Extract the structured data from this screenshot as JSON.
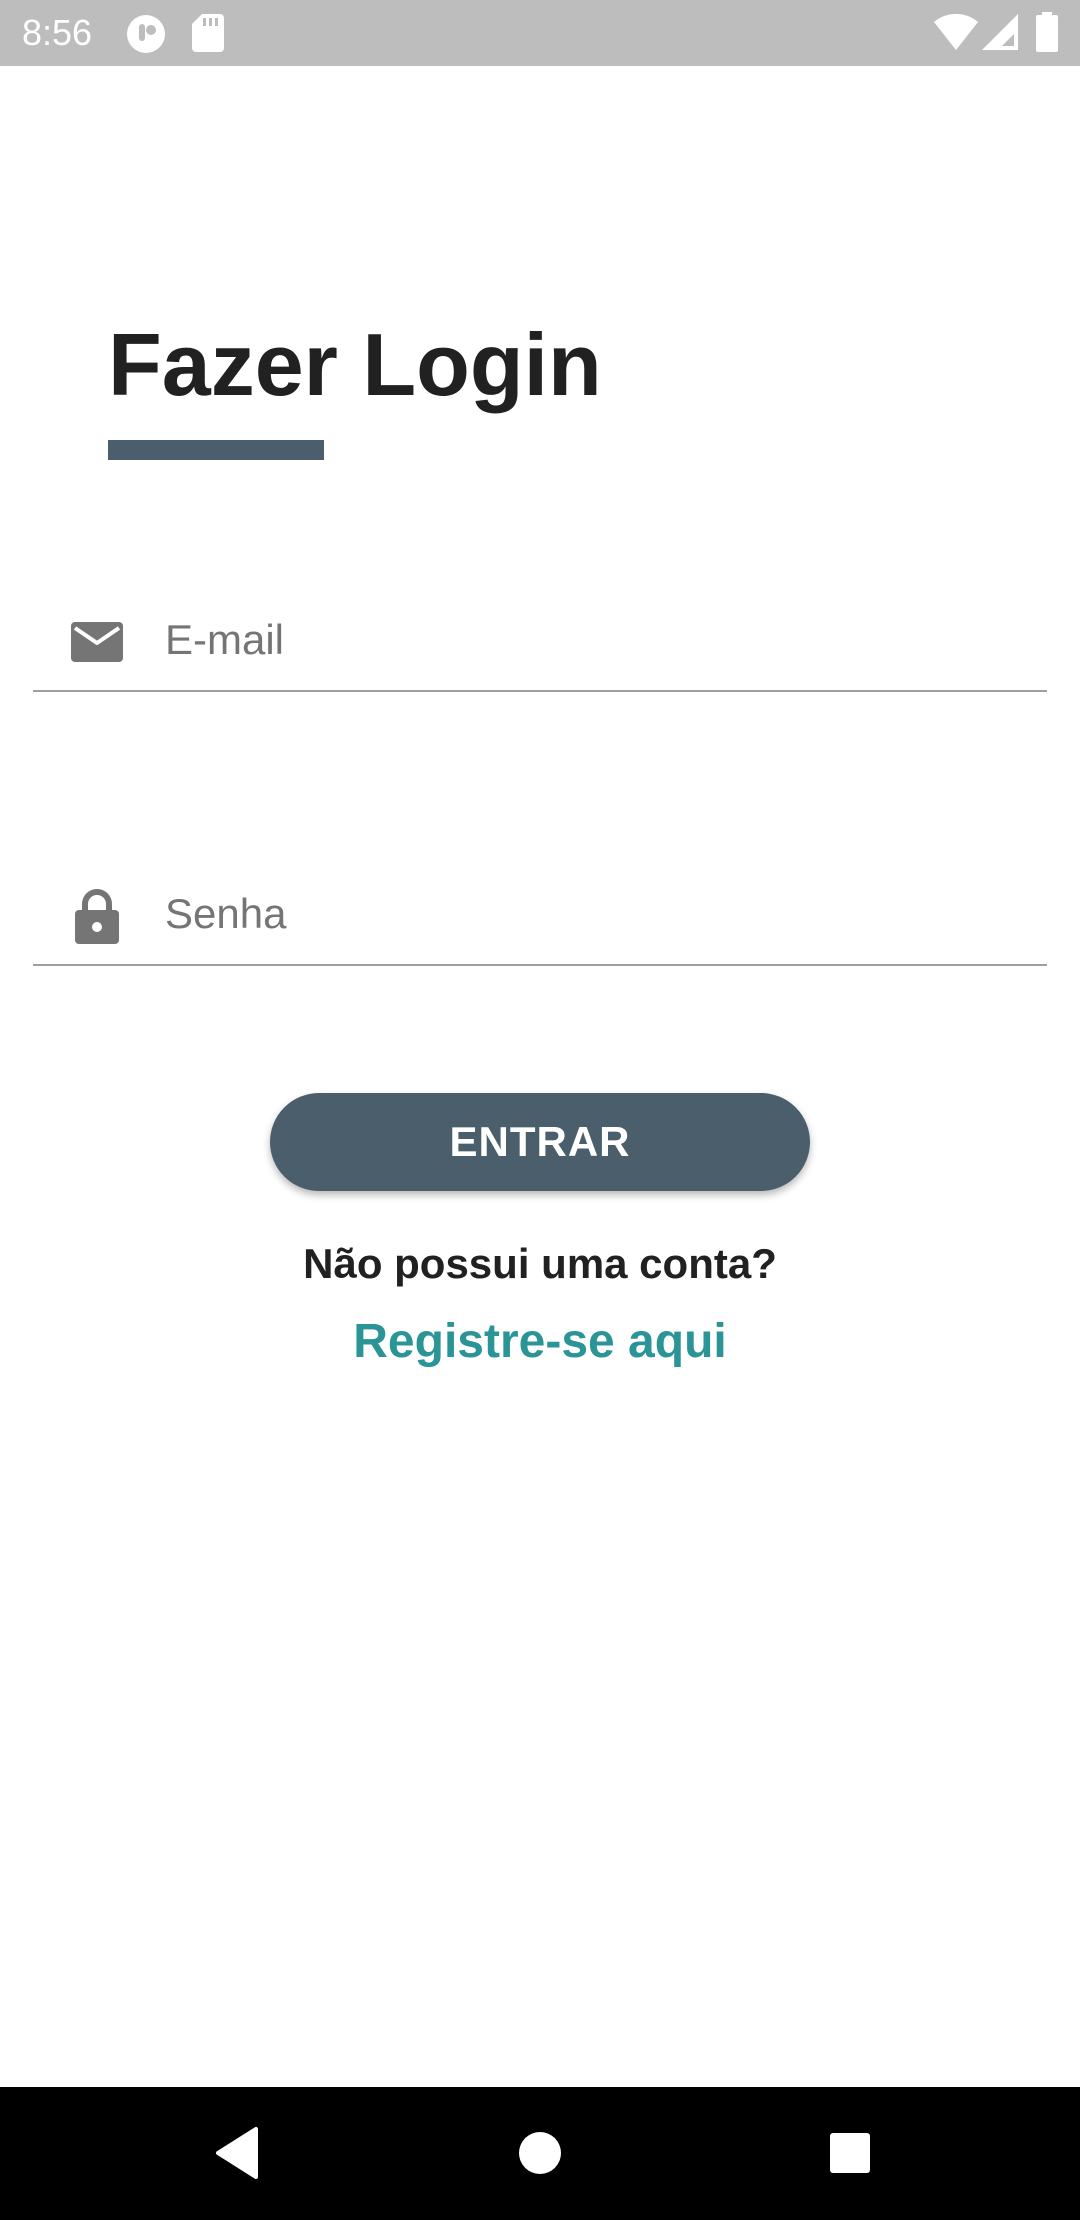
{
  "status_bar": {
    "time": "8:56",
    "icons": [
      "app-notification-icon",
      "sd-card-icon",
      "wifi-icon",
      "cell-signal-icon",
      "battery-icon"
    ]
  },
  "login": {
    "title": "Fazer Login",
    "email_placeholder": "E-mail",
    "password_placeholder": "Senha",
    "submit_label": "ENTRAR",
    "no_account_text": "Não possui uma conta?",
    "register_link": "Registre-se aqui"
  },
  "colors": {
    "primary": "#4a5f6b",
    "link": "#2a9496",
    "status_bar": "#bdbdbd",
    "nav_bar": "#000000"
  },
  "nav_bar": {
    "buttons": [
      "back-icon",
      "home-icon",
      "recents-icon"
    ]
  }
}
